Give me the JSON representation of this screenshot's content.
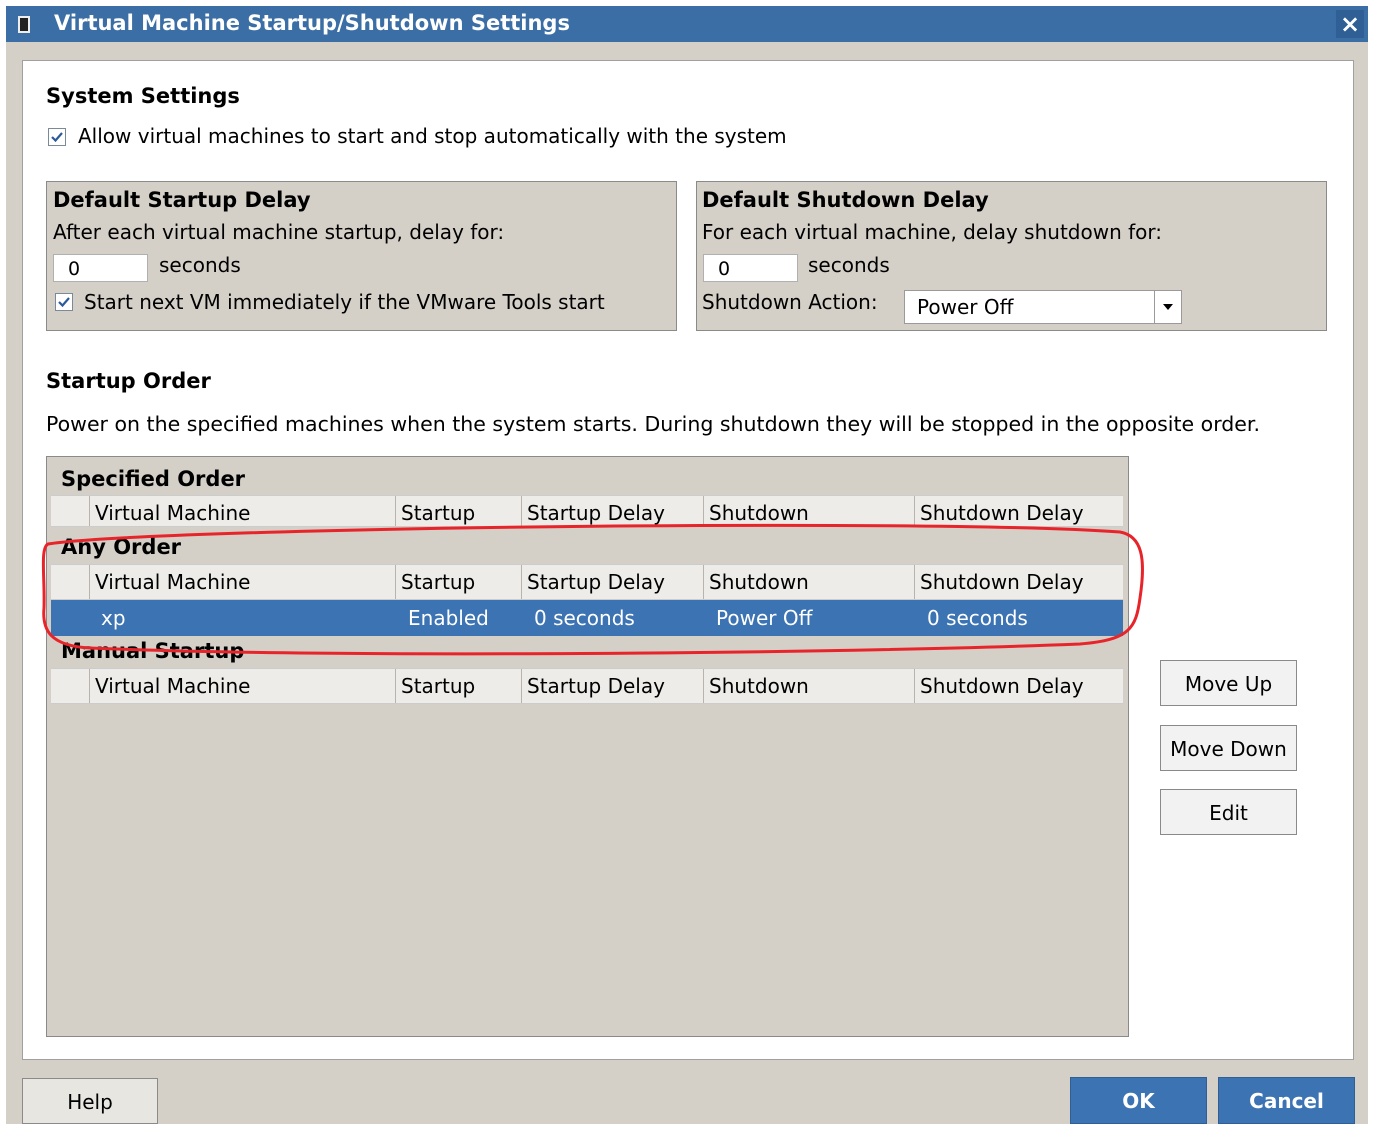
{
  "window": {
    "title": "Virtual Machine Startup/Shutdown Settings",
    "close_glyph": "×"
  },
  "system_settings": {
    "heading": "System Settings",
    "allow_auto_label": "Allow virtual machines to start and stop automatically with the system",
    "allow_auto_checked": true
  },
  "startup_delay": {
    "heading": "Default Startup Delay",
    "description": "After each virtual machine startup, delay for:",
    "value": "0",
    "unit": "seconds",
    "start_next_label": "Start next VM immediately if the VMware Tools start",
    "start_next_checked": true
  },
  "shutdown_delay": {
    "heading": "Default Shutdown Delay",
    "description": "For each virtual machine, delay shutdown for:",
    "value": "0",
    "unit": "seconds",
    "action_label": "Shutdown Action:",
    "action_value": "Power Off"
  },
  "startup_order": {
    "heading": "Startup Order",
    "description": "Power on the specified machines when the system starts. During shutdown they will be stopped in the opposite order.",
    "columns": [
      "Virtual Machine",
      "Startup",
      "Startup Delay",
      "Shutdown",
      "Shutdown Delay"
    ],
    "specified_label": "Specified Order",
    "any_label": "Any Order",
    "manual_label": "Manual Startup",
    "any_rows": [
      {
        "vm": "xp",
        "startup": "Enabled",
        "startup_delay": "0 seconds",
        "shutdown": "Power Off",
        "shutdown_delay": "0 seconds",
        "selected": true
      }
    ]
  },
  "side_buttons": {
    "move_up": "Move Up",
    "move_down": "Move Down",
    "edit": "Edit"
  },
  "footer": {
    "help": "Help",
    "ok": "OK",
    "cancel": "Cancel"
  },
  "annotation": {
    "highlight_color": "#e8242b"
  },
  "colors": {
    "title_bar": "#3a6ea5",
    "selection": "#3c73b3",
    "dialog_gray": "#d4d0c8"
  }
}
